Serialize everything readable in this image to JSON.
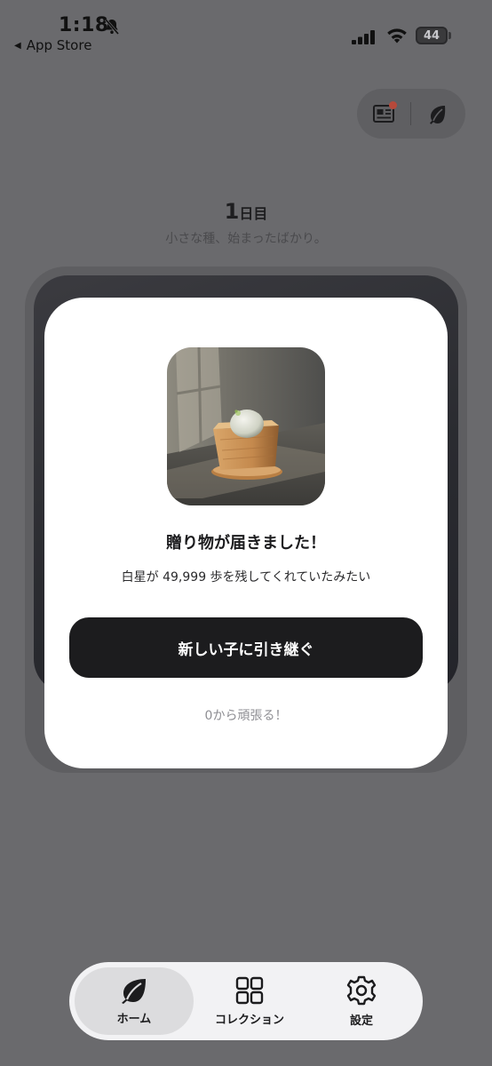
{
  "status_bar": {
    "time": "1:18",
    "back_label": "App Store",
    "battery": "44"
  },
  "header": {
    "day_number": "1",
    "day_unit": "日目",
    "subtitle": "小さな種、始まったばかり。"
  },
  "top_actions": {
    "icons": [
      "newspaper-icon",
      "leaf-icon"
    ],
    "notification_dot_color": "#b6493b"
  },
  "modal": {
    "title": "贈り物が届きました！",
    "message": "白星が 49,999 歩を残してくれていたみたい",
    "primary_button": "新しい子に引き継ぐ",
    "secondary_link": "0から頑張る！"
  },
  "tab_bar": {
    "items": [
      {
        "label": "ホーム",
        "icon": "leaf-icon",
        "active": true
      },
      {
        "label": "コレクション",
        "icon": "grid-icon",
        "active": false
      },
      {
        "label": "設定",
        "icon": "gear-icon",
        "active": false
      }
    ]
  },
  "colors": {
    "overlay_bg": "#6a6a6d",
    "modal_bg": "#ffffff",
    "primary_button_bg": "#1c1c1e",
    "accent_dot": "#b6493b"
  }
}
